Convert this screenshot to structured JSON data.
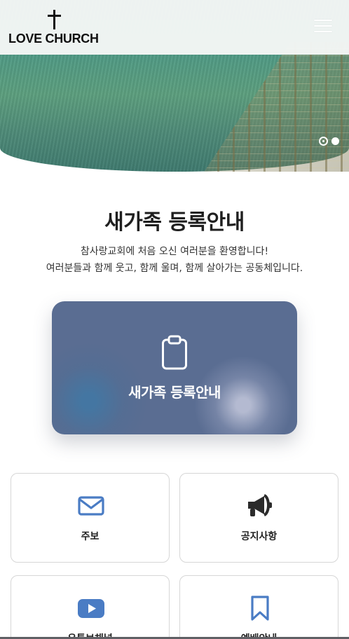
{
  "header": {
    "logo_text": "LOVE CHURCH",
    "menu_icon": "hamburger-menu-icon"
  },
  "hero": {
    "slide_count": 2,
    "active_slide": 1
  },
  "intro": {
    "title": "새가족 등록안내",
    "line1": "참사랑교회에 처음 오신 여러분을 환영합니다!",
    "line2": "여러분들과 함께 웃고, 함께 울며, 함께 살아가는 공동체입니다."
  },
  "register_card": {
    "label": "새가족 등록안내",
    "icon": "clipboard-icon"
  },
  "tiles": [
    {
      "label": "주보",
      "icon": "envelope-icon",
      "color": "#4a7cc4"
    },
    {
      "label": "공지사항",
      "icon": "megaphone-icon",
      "color": "#2b2b2b"
    },
    {
      "label": "유튜브채널",
      "icon": "youtube-icon",
      "color": "#4a7cc4"
    },
    {
      "label": "예배안내",
      "icon": "bookmark-icon",
      "color": "#4a7cc4"
    }
  ],
  "colors": {
    "card_bg": "#5a6d92",
    "accent": "#4a7cc4",
    "text": "#222222"
  }
}
